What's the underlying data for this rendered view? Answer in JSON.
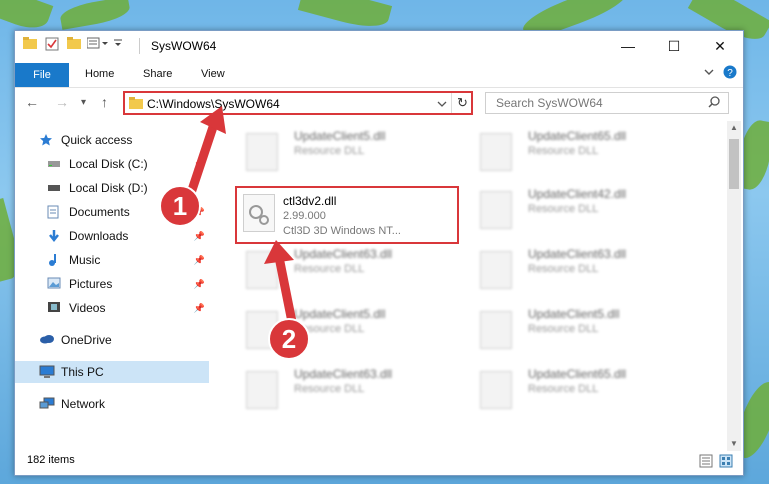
{
  "window": {
    "title": "SysWOW64",
    "controls": {
      "minimize": "—",
      "maximize": "☐",
      "close": "✕"
    }
  },
  "ribbon": {
    "tabs": [
      "File",
      "Home",
      "Share",
      "View"
    ],
    "expand_icon": "chevron-down-icon",
    "help_icon": "help-icon"
  },
  "navigation": {
    "back": "←",
    "forward": "→",
    "recent": "▾",
    "up": "↑",
    "address": "C:\\Windows\\SysWOW64",
    "refresh": "↻",
    "search_placeholder": "Search SysWOW64"
  },
  "sidebar": {
    "items": [
      {
        "label": "Quick access",
        "icon": "star-icon"
      },
      {
        "label": "Local Disk (C:)",
        "icon": "drive-icon"
      },
      {
        "label": "Local Disk (D:)",
        "icon": "drive-icon"
      },
      {
        "label": "Documents",
        "icon": "documents-icon"
      },
      {
        "label": "Downloads",
        "icon": "download-icon"
      },
      {
        "label": "Music",
        "icon": "music-icon"
      },
      {
        "label": "Pictures",
        "icon": "pictures-icon"
      },
      {
        "label": "Videos",
        "icon": "videos-icon"
      },
      {
        "label": "OneDrive",
        "icon": "cloud-icon"
      },
      {
        "label": "This PC",
        "icon": "computer-icon"
      },
      {
        "label": "Network",
        "icon": "network-icon"
      }
    ]
  },
  "files": {
    "highlighted": {
      "name": "ctl3dv2.dll",
      "version": "2.99.000",
      "description": "Ctl3D 3D Windows NT..."
    },
    "background": [
      {
        "name": "UpdateClient5.dll",
        "desc": "Resource DLL"
      },
      {
        "name": "UpdateClient65.dll",
        "desc": "Resource DLL"
      },
      {
        "name": "UpdateClient42.dll",
        "desc": "Resource DLL"
      },
      {
        "name": "UpdateClient63.dll",
        "desc": "Resource DLL"
      },
      {
        "name": "UpdateClient63.dll",
        "desc": "Resource DLL"
      },
      {
        "name": "UpdateClient5.dll",
        "desc": "Resource DLL"
      },
      {
        "name": "UpdateClient5.dll",
        "desc": "Resource DLL"
      },
      {
        "name": "UpdateClient63.dll",
        "desc": "Resource DLL"
      },
      {
        "name": "UpdateClient65.dll",
        "desc": "Resource DLL"
      }
    ]
  },
  "status": {
    "items_count": "182 items"
  },
  "annotations": {
    "step1": "1",
    "step2": "2",
    "accent": "#d9373a"
  }
}
